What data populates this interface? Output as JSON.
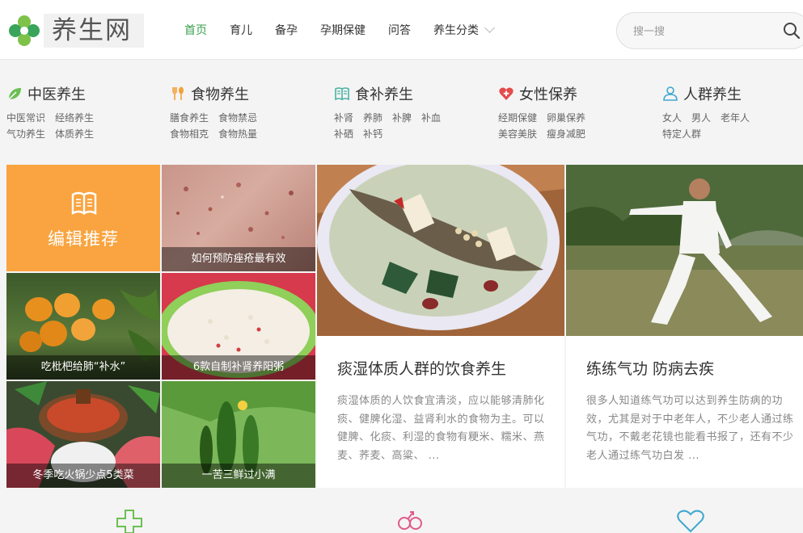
{
  "header": {
    "logo_text": "养生网",
    "nav": [
      {
        "label": "首页",
        "active": true
      },
      {
        "label": "育儿",
        "active": false
      },
      {
        "label": "备孕",
        "active": false
      },
      {
        "label": "孕期保健",
        "active": false
      },
      {
        "label": "问答",
        "active": false
      },
      {
        "label": "养生分类",
        "active": false
      }
    ],
    "search": {
      "placeholder": "搜一搜"
    }
  },
  "categories": [
    {
      "title": "中医养生",
      "icon": "leaf-icon",
      "color": "#6bbf54",
      "links": [
        "中医常识",
        "经络养生",
        "气功养生",
        "体质养生"
      ]
    },
    {
      "title": "食物养生",
      "icon": "fork-spoon-icon",
      "color": "#f2a23a",
      "links": [
        "膳食养生",
        "食物禁忌",
        "食物相克",
        "食物热量"
      ]
    },
    {
      "title": "食补养生",
      "icon": "book-icon",
      "color": "#4bb3a3",
      "links": [
        "补肾",
        "养肺",
        "补脾",
        "补血",
        "补硒",
        "补钙"
      ]
    },
    {
      "title": "女性保养",
      "icon": "heart-plus-icon",
      "color": "#e64a4a",
      "links": [
        "经期保健",
        "卵巢保养",
        "美容美肤",
        "瘦身减肥"
      ]
    },
    {
      "title": "人群养生",
      "icon": "people-icon",
      "color": "#3ea7cf",
      "links": [
        "女人",
        "男人",
        "老年人",
        "特定人群"
      ]
    }
  ],
  "editor": {
    "label": "编辑推荐",
    "color": "#f9a440"
  },
  "tiles": [
    {
      "caption": "如何预防痤疮最有效"
    },
    {
      "caption": "吃枇杷给肺“补水”"
    },
    {
      "caption": "6款自制补肾养阳粥"
    },
    {
      "caption": "冬季吃火锅少点5类菜"
    },
    {
      "caption": "一苦三鲜过小满"
    }
  ],
  "cards": [
    {
      "title": "痰湿体质人群的饮食养生",
      "desc": "痰湿体质的人饮食宜清淡，应以能够清肺化痰、健脾化湿、益肾利水的食物为主。可以健脾、化痰、利湿的食物有粳米、糯米、燕麦、荞麦、高粱、 ..."
    },
    {
      "title": "练练气功 防病去疾",
      "desc": "很多人知道练气功可以达到养生防病的功效，尤其是对于中老年人，不少老人通过练气功，不戴老花镜也能看书报了，还有不少老人通过练气功白发 ..."
    }
  ],
  "colors": {
    "accent_green": "#3a9e4c",
    "editor_orange": "#f9a440"
  }
}
